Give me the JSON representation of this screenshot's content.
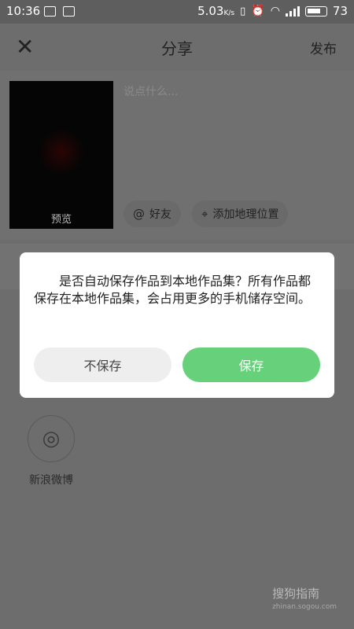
{
  "status_bar": {
    "time": "10:36",
    "network_speed": "5.03",
    "network_unit": "K/s",
    "battery": "73"
  },
  "header": {
    "title": "分享",
    "publish_label": "发布",
    "close_icon": "close-icon"
  },
  "compose": {
    "preview_label": "预览",
    "placeholder": "说点什么...",
    "mention_label": "好友",
    "location_label": "添加地理位置"
  },
  "share_targets": [
    {
      "label": "新浪微博",
      "icon": "weibo-icon"
    }
  ],
  "dialog": {
    "message": "是否自动保存作品到本地作品集？所有作品都保存在本地作品集，会占用更多的手机储存空间。",
    "cancel_label": "不保存",
    "confirm_label": "保存"
  },
  "watermark": {
    "brand": "搜狗指南",
    "url": "zhinan.sogou.com"
  },
  "colors": {
    "accent_green": "#66d07a",
    "overlay_gray": "#6d6d6d"
  }
}
